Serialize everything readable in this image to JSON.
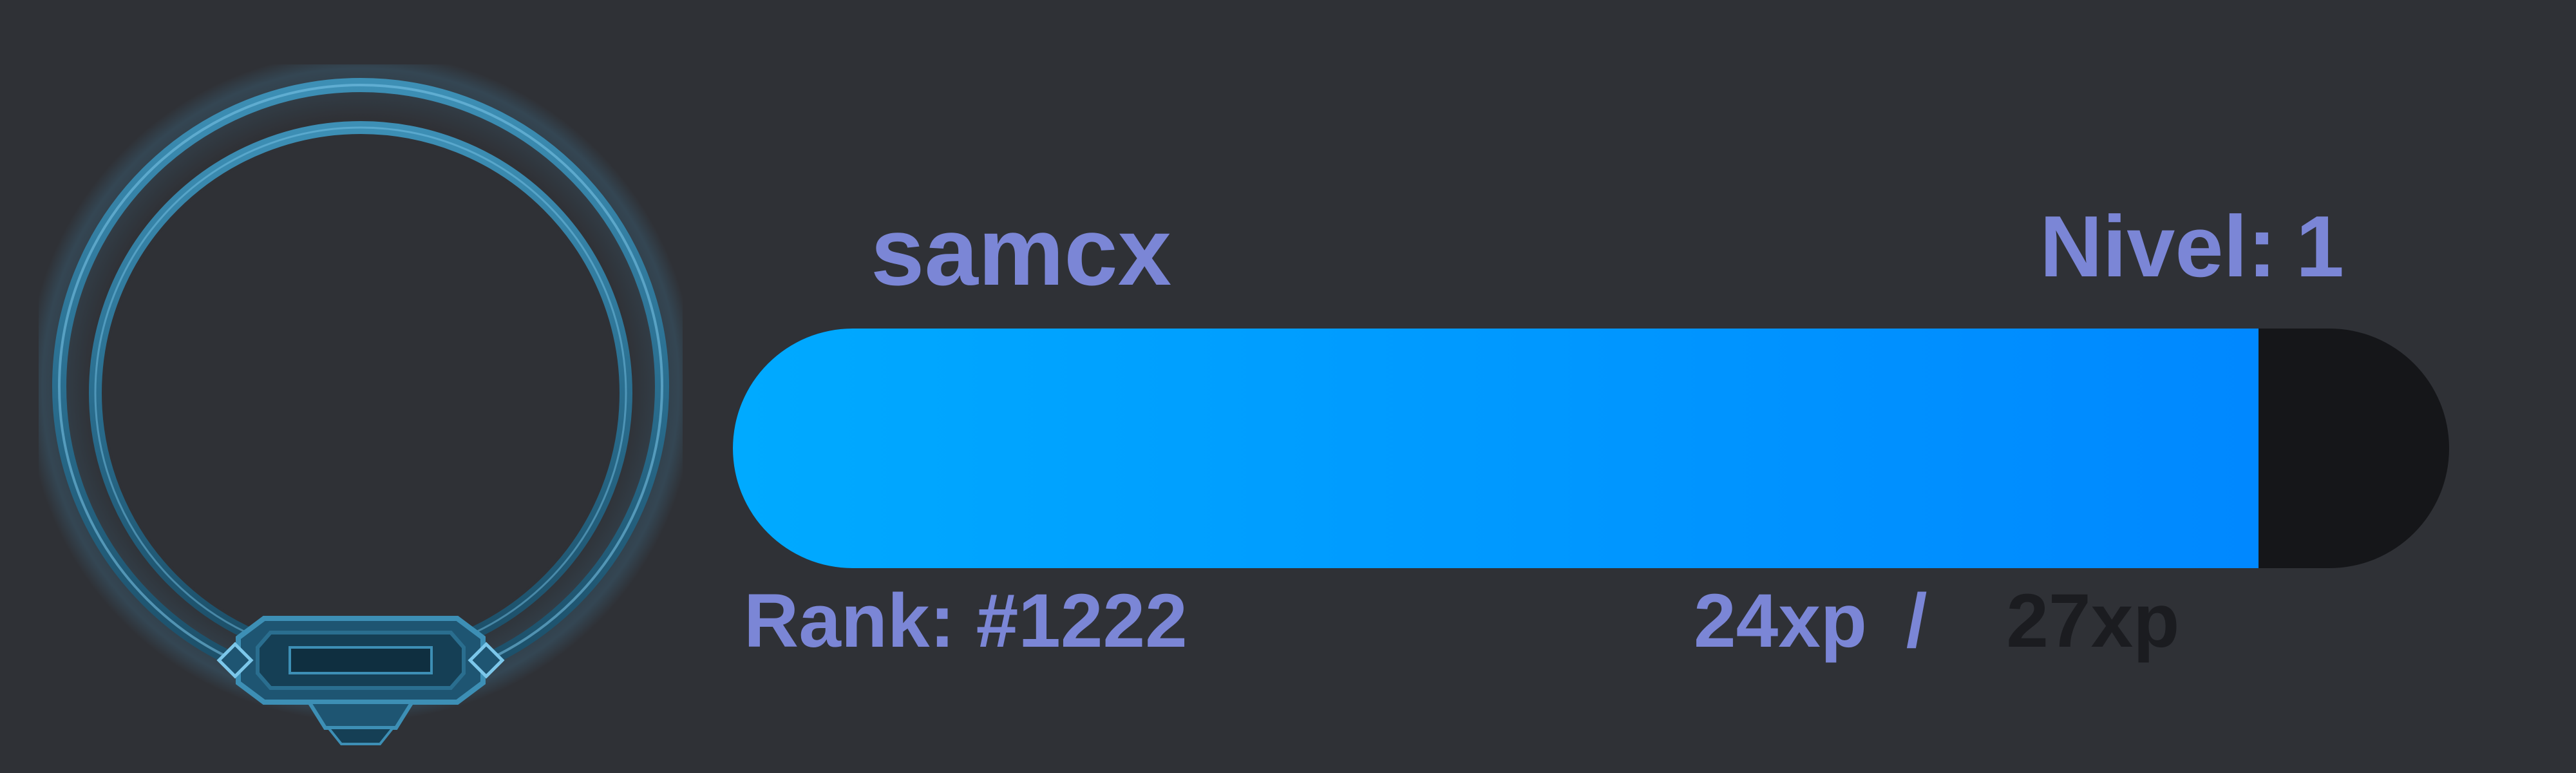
{
  "profile": {
    "username": "samcx",
    "level_label": "Nivel:",
    "level_value": "1",
    "rank": "Rank: #1222",
    "xp_current": "24xp",
    "xp_separator": "/",
    "xp_max": "27xp",
    "xp_progress": 0.889
  },
  "colors": {
    "background": "#2f3136",
    "text": "#7b86d6",
    "xp_bar_start": "#00aaff",
    "xp_bar_end": "#0088ff",
    "xp_track": "#151619",
    "xp_max_text": "#1b1c20",
    "frame": "#2a6e8f"
  },
  "icons": {
    "avatar_frame": "ornate-ring-frame-icon"
  }
}
